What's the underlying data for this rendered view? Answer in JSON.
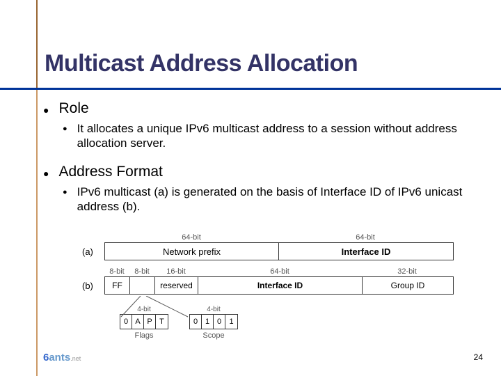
{
  "title": "Multicast Address Allocation",
  "sections": [
    {
      "heading": "Role",
      "items": [
        "It allocates a unique IPv6 multicast address to a session without address allocation server."
      ]
    },
    {
      "heading": "Address Format",
      "items": [
        "IPv6 multicast (a) is generated on the basis of Interface ID of IPv6 unicast address (b)."
      ]
    }
  ],
  "diagram": {
    "row_a": {
      "label": "(a)",
      "widths": [
        "64-bit",
        "64-bit"
      ],
      "fields": [
        "Network prefix",
        "Interface ID"
      ]
    },
    "row_b": {
      "label": "(b)",
      "widths": [
        "8-bit",
        "8-bit",
        "16-bit",
        "64-bit",
        "32-bit"
      ],
      "fields": [
        "FF",
        "",
        "reserved",
        "Interface ID",
        "Group ID"
      ]
    },
    "sub_widths": [
      "4-bit",
      "4-bit"
    ],
    "flags": {
      "label": "Flags",
      "cells": [
        "0",
        "A",
        "P",
        "T"
      ]
    },
    "scope": {
      "label": "Scope",
      "cells": [
        "0",
        "1",
        "0",
        "1"
      ]
    }
  },
  "footer": {
    "logo_prefix": "6",
    "logo_text": "ants",
    "logo_suffix": ".net"
  },
  "page": "24"
}
